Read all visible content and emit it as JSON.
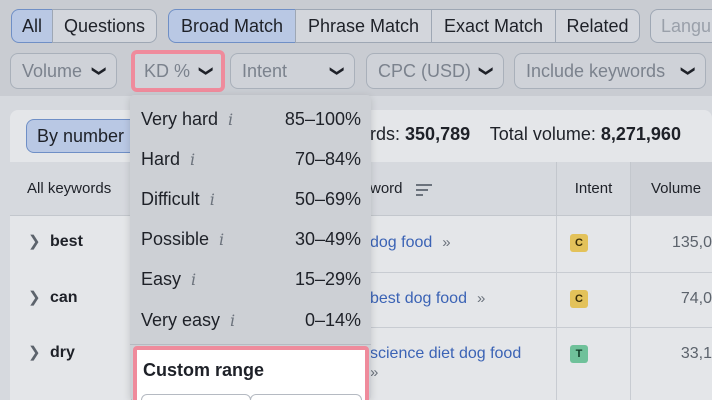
{
  "tabs": {
    "all": "All",
    "questions": "Questions",
    "broad_match": "Broad Match",
    "phrase_match": "Phrase Match",
    "exact_match": "Exact Match",
    "related": "Related",
    "languages": "Langu"
  },
  "filters": {
    "volume": "Volume",
    "kd": "KD %",
    "intent": "Intent",
    "cpc": "CPC (USD)",
    "include_keywords": "Include keywords",
    "chevron": "❯"
  },
  "toolbar": {
    "by_number": "By number",
    "keywords_label": "rds:",
    "keywords_value": "350,789",
    "total_volume_label": "Total volume:",
    "total_volume_value": "8,271,960"
  },
  "table": {
    "headers": {
      "all_keywords": "All keywords",
      "keyword": "word",
      "intent": "Intent",
      "volume": "Volume"
    },
    "groups": [
      {
        "label": "best"
      },
      {
        "label": "can"
      },
      {
        "label": "dry"
      }
    ],
    "rows": [
      {
        "keyword": "dog food",
        "intent": "C",
        "volume": "135,0"
      },
      {
        "keyword": "best dog food",
        "intent": "C",
        "volume": "74,0"
      },
      {
        "keyword": "science diet dog food",
        "intent": "T",
        "volume": "33,1"
      }
    ],
    "arrows": "»"
  },
  "kd_dropdown": {
    "items": [
      {
        "label": "Very hard",
        "range": "85–100%"
      },
      {
        "label": "Hard",
        "range": "70–84%"
      },
      {
        "label": "Difficult",
        "range": "50–69%"
      },
      {
        "label": "Possible",
        "range": "30–49%"
      },
      {
        "label": "Easy",
        "range": "15–29%"
      },
      {
        "label": "Very easy",
        "range": "0–14%"
      }
    ],
    "info_glyph": "i",
    "custom_range_title": "Custom range"
  },
  "colors": {
    "accent_highlight": "#ef8b9c",
    "active_tab": "#b9c8e4",
    "link": "#3b63b5",
    "badge_commercial": "#e3c25a",
    "badge_transactional": "#6fc19a"
  }
}
